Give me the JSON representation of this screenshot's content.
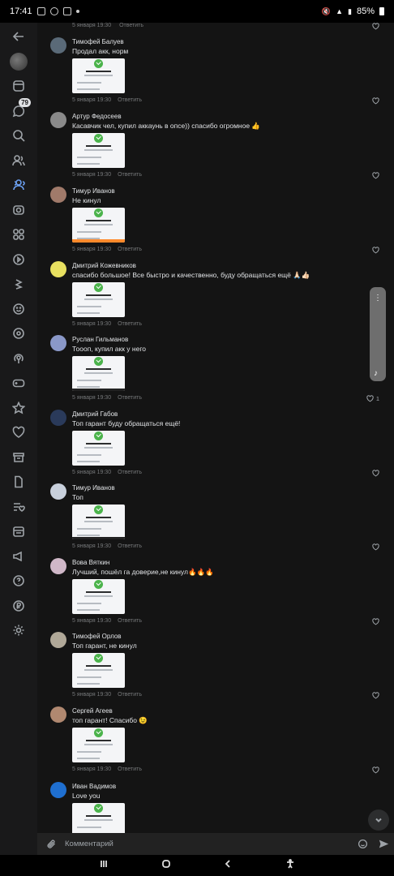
{
  "status_bar": {
    "time": "17:41",
    "battery": "85%"
  },
  "rail": {
    "messages_badge": "79"
  },
  "comments": [
    {
      "name": "Тимофей Балуев",
      "text": "Продал акк, норм",
      "date": "5 января 19:30",
      "reply": "Ответить",
      "avatar_color": "#5a6a78"
    },
    {
      "name": "Артур Федосеев",
      "text": "Касавчик чел, купил аккаунь в опсе)) спасибо огромное 👍",
      "date": "5 января 19:30",
      "reply": "Ответить",
      "avatar_color": "#8a8a8a"
    },
    {
      "name": "Тимур Иванов",
      "text": "Не кинул",
      "date": "5 января 19:30",
      "reply": "Ответить",
      "avatar_color": "#a07a6a"
    },
    {
      "name": "Дмитрий Кожевников",
      "text": "спасибо большое! Все быстро и качественно, буду обращаться ещё 🙏🏻👍🏻",
      "date": "5 января 19:30",
      "reply": "Ответить",
      "avatar_color": "#e8e060"
    },
    {
      "name": "Руслан Гильманов",
      "text": "Тоооп, купил акк у него",
      "date": "5 января 19:30",
      "reply": "Ответить",
      "avatar_color": "#8a98c8",
      "likes": "1"
    },
    {
      "name": "Дмитрий Габов",
      "text": "Топ гарант буду обращаться ещё!",
      "date": "5 января 19:30",
      "reply": "Ответить",
      "avatar_color": "#2a3a5a"
    },
    {
      "name": "Тимур Иванов",
      "text": "Топ",
      "date": "5 января 19:30",
      "reply": "Ответить",
      "avatar_color": "#c8d0dc"
    },
    {
      "name": "Вова Вяткин",
      "text": "Лучший, пошёл га доверие,не кинул🔥🔥🔥",
      "date": "5 января 19:30",
      "reply": "Ответить",
      "avatar_color": "#d0b8c8"
    },
    {
      "name": "Тимофей Орлов",
      "text": "Топ гарант, не кинул",
      "date": "5 января 19:30",
      "reply": "Ответить",
      "avatar_color": "#b0a898"
    },
    {
      "name": "Сергей Агеев",
      "text": "топ гарант! Спасибо 😉",
      "date": "5 января 19:30",
      "reply": "Ответить",
      "avatar_color": "#b08870"
    },
    {
      "name": "Иван Вадимов",
      "text": "Love  you",
      "avatar_color": "#1f6fd0"
    }
  ],
  "composer": {
    "placeholder": "Комментарий"
  }
}
